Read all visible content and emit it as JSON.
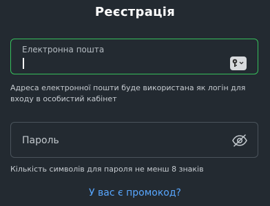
{
  "header": {
    "title": "Реєстрація"
  },
  "email": {
    "label": "Електронна пошта",
    "value": "",
    "hint": "Адреса електронної пошти буде використана як логін для входу в особистий кабінет",
    "key_icon": "key-icon"
  },
  "password": {
    "label": "Пароль",
    "hint": "Кількість символів для пароля не менш 8 знаків",
    "toggle_icon": "eye-off-icon"
  },
  "promo": {
    "link_text": "У вас є промокод?"
  },
  "colors": {
    "background": "#232a31",
    "active_border": "#36c15c",
    "inactive_border": "#4b545c",
    "link": "#58a7ff"
  }
}
